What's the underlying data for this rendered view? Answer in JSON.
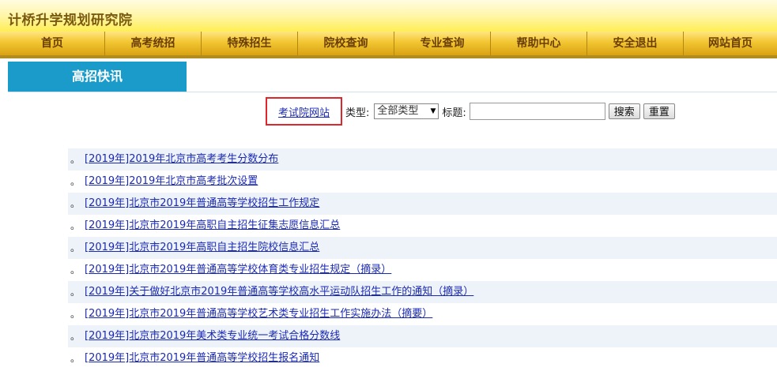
{
  "header": {
    "site_title": "计桥升学规划研究院"
  },
  "nav": {
    "items": [
      {
        "label": "首页"
      },
      {
        "label": "高考统招"
      },
      {
        "label": "特殊招生"
      },
      {
        "label": "院校查询"
      },
      {
        "label": "专业查询"
      },
      {
        "label": "帮助中心"
      },
      {
        "label": "安全退出"
      },
      {
        "label": "网站首页"
      }
    ]
  },
  "section": {
    "title": "高招快讯"
  },
  "toolbar": {
    "site_link": "考试院网站",
    "type_label": "类型:",
    "type_selected": "全部类型",
    "title_label": "标题:",
    "title_value": "",
    "search_label": "搜索",
    "reset_label": "重置"
  },
  "news": {
    "bullet": "。",
    "items": [
      {
        "text": "[2019年]2019年北京市高考考生分数分布"
      },
      {
        "text": "[2019年]2019年北京市高考批次设置"
      },
      {
        "text": "[2019年]北京市2019年普通高等学校招生工作规定"
      },
      {
        "text": "[2019年]北京市2019年高职自主招生征集志愿信息汇总"
      },
      {
        "text": "[2019年]北京市2019年高职自主招生院校信息汇总"
      },
      {
        "text": "[2019年]北京市2019年普通高等学校体育类专业招生规定（摘录）"
      },
      {
        "text": "[2019年]关于做好北京市2019年普通高等学校高水平运动队招生工作的通知（摘录）"
      },
      {
        "text": "[2019年]北京市2019年普通高等学校艺术类专业招生工作实施办法（摘要）"
      },
      {
        "text": "[2019年]北京市2019年美术类专业统一考试合格分数线"
      },
      {
        "text": "[2019年]北京市2019年普通高等学校招生报名通知"
      }
    ]
  },
  "colors": {
    "nav_text": "#6a3e05",
    "section_tab": "#1a9bc9",
    "link": "#1a2ab3",
    "highlight_box": "#e0262d"
  }
}
